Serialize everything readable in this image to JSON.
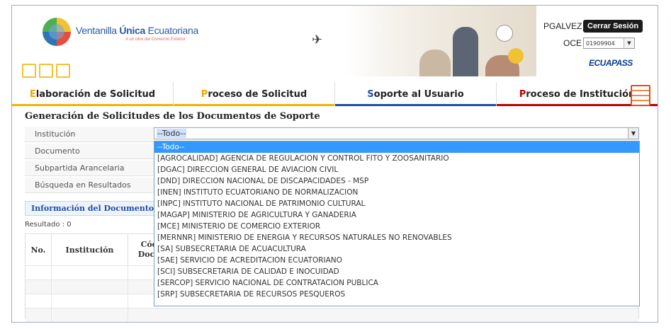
{
  "header": {
    "logo_text_plain": "Ventanilla ",
    "logo_text_bold": "Única",
    "logo_text_tail": " Ecuatoriana",
    "logo_sub": "A un click del Comercio Exterior",
    "user": "PGALVEZ",
    "logout_label": "Cerrar Sesión",
    "oce_label": "OCE",
    "oce_value": "01909904",
    "brand": "ECUAPASS"
  },
  "nav": {
    "items": [
      {
        "first": "E",
        "rest": "laboración de Solicitud"
      },
      {
        "first": "P",
        "rest": "roceso de Solicitud"
      },
      {
        "first": "S",
        "rest": "oporte al Usuario"
      },
      {
        "first": "P",
        "rest": "roceso de Institución"
      }
    ]
  },
  "page": {
    "title": "Generación de Solicitudes de los Documentos de Soporte"
  },
  "filters": {
    "institucion_label": "Institución",
    "documento_label": "Documento",
    "subpartida_label": "Subpartida Arancelaria",
    "busqueda_label": "Búsqueda en Resultados",
    "institucion_value": "--Todo--"
  },
  "tabs": {
    "tab1": "Información del Documento"
  },
  "results": {
    "count": "Resultado : 0"
  },
  "table": {
    "col_no": "No.",
    "col_institucion": "Institución",
    "col_codigo": "Cód\nDocu"
  },
  "dropdown": {
    "options": [
      "--Todo--",
      "[AGROCALIDAD] AGENCIA DE REGULACION Y CONTROL FITO Y ZOOSANITARIO",
      "[DGAC] DIRECCION GENERAL DE AVIACION CIVIL",
      "[DND] DIRECCION NACIONAL DE DISCAPACIDADES - MSP",
      "[INEN] INSTITUTO ECUATORIANO DE NORMALIZACION",
      "[INPC] INSTITUTO NACIONAL DE PATRIMONIO CULTURAL",
      "[MAGAP] MINISTERIO DE AGRICULTURA Y GANADERIA",
      "[MCE] MINISTERIO DE COMERCIO EXTERIOR",
      "[MERNNR] MINISTERIO DE ENERGIA Y RECURSOS NATURALES NO RENOVABLES",
      "[SA] SUBSECRETARIA DE ACUACULTURA",
      "[SAE] SERVICIO DE ACREDITACION ECUATORIANO",
      "[SCI] SUBSECRETARIA DE CALIDAD E INOCUIDAD",
      "[SERCOP] SERVICIO NACIONAL DE CONTRATACION PUBLICA",
      "[SRP] SUBSECRETARIA DE RECURSOS PESQUEROS"
    ]
  },
  "icons": {
    "logo": "globe-logo-icon",
    "plane": "airplane-icon",
    "dropdown": "chevron-down-icon"
  },
  "colors": {
    "accent_yellow": "#f0b400",
    "accent_blue": "#1f4fa8",
    "accent_red": "#c00000",
    "selection_blue": "#3399ff"
  }
}
